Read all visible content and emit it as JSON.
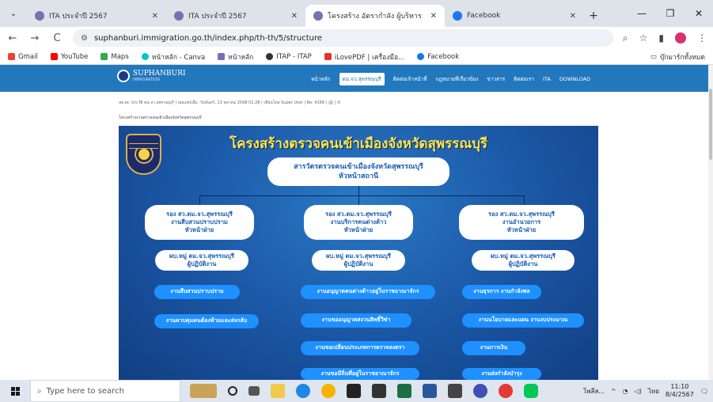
{
  "tabs": [
    {
      "title": "ITA ประจำปี 2567",
      "active": false
    },
    {
      "title": "ITA ประจำปี 2567",
      "active": false
    },
    {
      "title": "โครงสร้าง อัตรากำลัง ผู้บริหาร",
      "active": true
    },
    {
      "title": "Facebook",
      "active": false
    }
  ],
  "toolbar": {
    "url": "suphanburi.immigration.go.th/index.php/th-th/5/structure",
    "back": "←",
    "forward": "→",
    "reload": "C"
  },
  "bookmarks": [
    {
      "label": "Gmail",
      "color": "#ea4335"
    },
    {
      "label": "YouTube",
      "color": "#ff0000"
    },
    {
      "label": "Maps",
      "color": "#34a853"
    },
    {
      "label": "หน้าหลัก - Canva",
      "color": "#00c4cc"
    },
    {
      "label": "หน้าหลัก",
      "color": "#7a6fb0"
    },
    {
      "label": "ITAP - ITAP",
      "color": "#333333"
    },
    {
      "label": "iLovePDF | เครื่องมือ...",
      "color": "#e5322d"
    },
    {
      "label": "Facebook",
      "color": "#1877f2"
    }
  ],
  "bookmarks_right": "บุ๊กมาร์กทั้งหมด",
  "site": {
    "brand": "SUPHANBURI",
    "brand_sub": "IMMIGRATION",
    "menu": [
      "หน้าหลัก",
      "ตม.จว.สุพรรณบุรี",
      "ติดต่อเจ้าหน้าที่",
      "กฎหมายที่เกี่ยวข้อง",
      "ข่าวสาร",
      "ติดต่อเรา",
      "ITA",
      "DOWNLOAD"
    ],
    "menu_active_index": 1,
    "meta": "หมวด: ประวัติ ตม.จว.สุพรรณบุรี | เผยแพร่เมื่อ: วันจันทร์, 13 ตุลาคม 2568 01:28 | เขียนโดย Super User | ฮิต: 4168 | 🖨 | ✉",
    "breadcrumb": "โครงสร้างงานตรวจคนเข้าเมืองจังหวัดสุพรรณบุรี"
  },
  "poster": {
    "title": "โครงสร้างตรวจคนเข้าเมืองจังหวัดสุพรรณบุรี",
    "head": {
      "line1": "สารวัตรตรวจคนเข้าเมืองจังหวัดสุพรรณบุรี",
      "line2": "หัวหน้าสถานี"
    },
    "deputies": [
      {
        "l1": "รอง สว.ตม.จว.สุพรรณบุรี",
        "l2": "งานสืบสวนปราบปราม",
        "l3": "หัวหน้าฝ่าย"
      },
      {
        "l1": "รอง สว.ตม.จว.สุพรรณบุรี",
        "l2": "งานบริการคนต่างด้าว",
        "l3": "หัวหน้าฝ่าย"
      },
      {
        "l1": "รอง สว.ตม.จว.สุพรรณบุรี",
        "l2": "งานอำนวยการ",
        "l3": "หัวหน้าฝ่าย"
      }
    ],
    "operators": [
      {
        "l1": "ผบ.หมู่ ตม.จว.สุพรรณบุรี",
        "l2": "ผู้ปฏิบัติงาน"
      },
      {
        "l1": "ผบ.หมู่ ตม.จว.สุพรรณบุรี",
        "l2": "ผู้ปฏิบัติงาน"
      },
      {
        "l1": "ผบ.หมู่ ตม.จว.สุพรรณบุรี",
        "l2": "ผู้ปฏิบัติงาน"
      }
    ],
    "col1_units": [
      "งานสืบสวนปราบปราม",
      "งานควบคุมคนต้องห้ามและส่งกลับ"
    ],
    "col2_units": [
      "งานอนุญาตคนต่างด้าวอยู่ในราชอาณาจักร",
      "งานขออนุญาตสงวนสิทธิ์วีซ่า",
      "งานขอเปลี่ยนประเภทการตรวจลงตรา",
      "งานขอมีถิ่นที่อยู่ในราชอาณาจักร"
    ],
    "col3_units": [
      "งานธุรการ งานกำลังพล",
      "งานนโยบายและแผน งานงบประมาณ",
      "งานการเงิน",
      "งานส่งกำลังบำรุง"
    ]
  },
  "taskbar": {
    "search_placeholder": "Type here to search",
    "tray_lang": "ไทย",
    "time": "11:10",
    "date": "8/4/2567",
    "weather": "โพลีส..."
  }
}
